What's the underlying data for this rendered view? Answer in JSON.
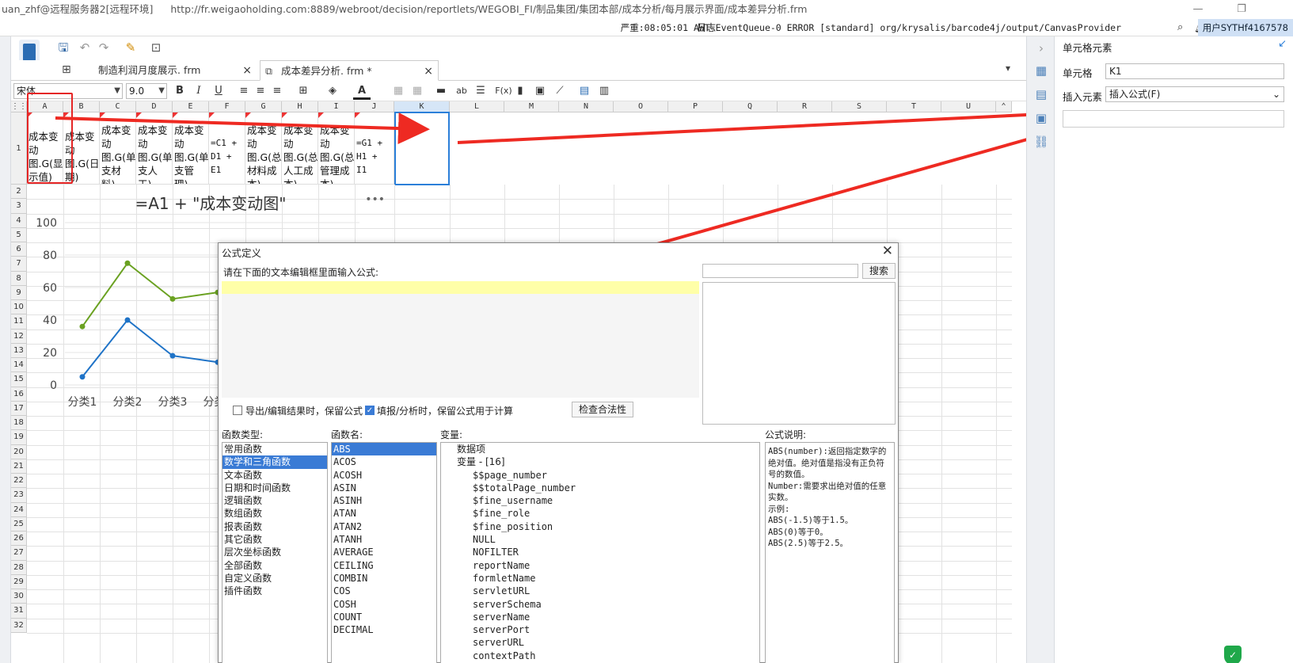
{
  "window": {
    "title": "uan_zhf@远程服务器2[远程环境]",
    "url": "http://fr.weigaoholding.com:8889/webroot/decision/reportlets/WEGOBI_FI/制品集团/集团本部/成本分析/每月展示界面/成本差异分析.frm"
  },
  "status": {
    "log_label": "日志",
    "message": "严重:08:05:01 AWT-EventQueue-0 ERROR [standard] org/krysalis/barcode4j/output/CanvasProvider",
    "user": "用户SYTHf4167578"
  },
  "tabs": [
    {
      "label": "制造利润月度展示. frm",
      "close": "×"
    },
    {
      "label": "成本差异分析. frm *",
      "close": "×"
    }
  ],
  "format": {
    "font": "宋体",
    "size": "9.0",
    "bold": "B",
    "italic": "I",
    "underline": "U",
    "ab": "ab",
    "fx": "F(x)"
  },
  "grid": {
    "columns": [
      "A",
      "B",
      "C",
      "D",
      "E",
      "F",
      "G",
      "H",
      "I",
      "J",
      "K",
      "L",
      "M",
      "N",
      "O",
      "P",
      "Q",
      "R",
      "S",
      "T",
      "U"
    ],
    "rows": [
      "1",
      "2",
      "3",
      "4",
      "5",
      "6",
      "7",
      "8",
      "9",
      "10",
      "11",
      "12",
      "13",
      "14",
      "15",
      "16",
      "17",
      "18",
      "19",
      "20",
      "21",
      "22",
      "23",
      "24",
      "25",
      "26",
      "27",
      "28",
      "29",
      "30",
      "31",
      "32"
    ],
    "row1_cells": [
      "成本变动图.G(显示值)",
      "成本变动图.G(日期)",
      "成本变动图.G(单支材料)",
      "成本变动图.G(单支人工)",
      "成本变动图.G(单支管理)",
      "=C1 + D1 + E1",
      "成本变动图.G(总材料成本)",
      "成本变动图.G(总人工成本)",
      "成本变动图.G(总管理成本)",
      "=G1 + H1 + I1"
    ]
  },
  "chart_data": {
    "type": "line",
    "title": "=A1 + \"成本变动图\"",
    "menu": "•••",
    "categories": [
      "分类1",
      "分类2",
      "分类3",
      "分类4"
    ],
    "yticks": [
      "100",
      "80",
      "60",
      "40",
      "20",
      "0"
    ],
    "ylim": [
      0,
      100
    ],
    "series": [
      {
        "color": "#6aa121",
        "values": [
          36,
          75,
          53,
          57
        ]
      },
      {
        "color": "#1f73c7",
        "values": [
          5,
          40,
          18,
          14
        ]
      }
    ]
  },
  "rpanel": {
    "title": "单元格元素",
    "cell_label": "单元格",
    "cell_value": "K1",
    "insert_label": "插入元素",
    "insert_value": "插入公式(F)"
  },
  "dialog": {
    "title": "公式定义",
    "prompt": "请在下面的文本编辑框里面输入公式:",
    "search": "搜索",
    "opt1": "导出/编辑结果时，保留公式",
    "opt2": "填报/分析时，保留公式用于计算",
    "check": "检查合法性",
    "types_label": "函数类型:",
    "names_label": "函数名:",
    "vars_label": "变量:",
    "desc_label": "公式说明:",
    "types": [
      "常用函数",
      "数学和三角函数",
      "文本函数",
      "日期和时间函数",
      "逻辑函数",
      "数组函数",
      "报表函数",
      "其它函数",
      "层次坐标函数",
      "全部函数",
      "自定义函数",
      "插件函数"
    ],
    "names": [
      "ABS",
      "ACOS",
      "ACOSH",
      "ASIN",
      "ASINH",
      "ATAN",
      "ATAN2",
      "ATANH",
      "AVERAGE",
      "CEILING",
      "COMBIN",
      "COS",
      "COSH",
      "COUNT",
      "DECIMAL"
    ],
    "var_data": "数据项",
    "var_group": "变量 - [16]",
    "vars": [
      "$$page_number",
      "$$totalPage_number",
      "$fine_username",
      "$fine_role",
      "$fine_position",
      "NULL",
      "NOFILTER",
      "reportName",
      "formletName",
      "servletURL",
      "serverSchema",
      "serverName",
      "serverPort",
      "serverURL",
      "contextPath"
    ],
    "desc": "ABS(number):返回指定数字的绝对值。绝对值是指没有正负符号的数值。\nNumber:需要求出绝对值的任意实数。\n示例:\nABS(-1.5)等于1.5。\nABS(0)等于0。\nABS(2.5)等于2.5。"
  }
}
